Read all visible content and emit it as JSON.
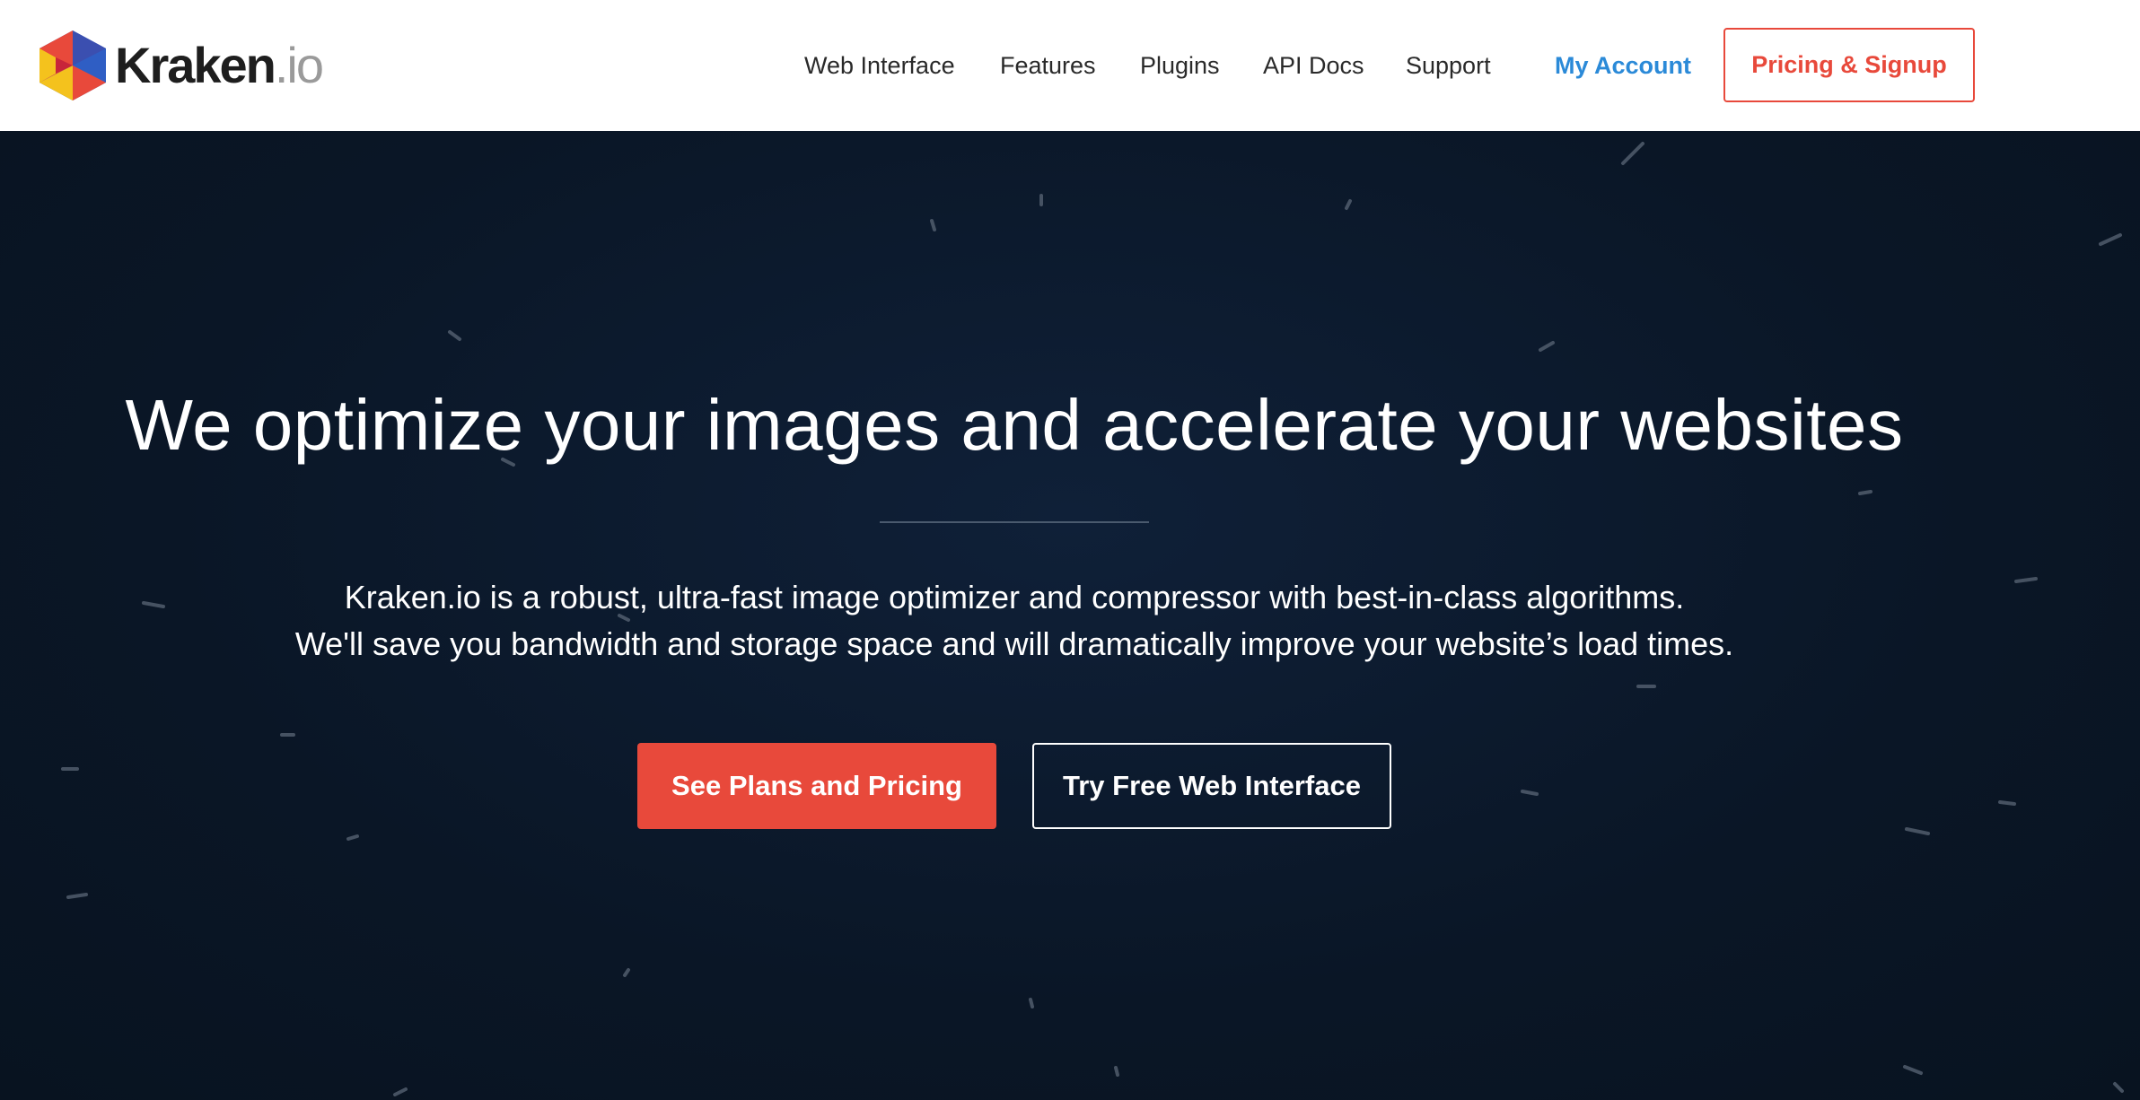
{
  "brand": {
    "word": "Kraken",
    "tld": ".io",
    "logo_icon": "hexagon-cube-icon",
    "colors": {
      "accent_red": "#e8493b",
      "accent_blue": "#2b8ad8",
      "hero_bg": "#0b1727"
    }
  },
  "nav": {
    "items": [
      {
        "label": "Web Interface"
      },
      {
        "label": "Features"
      },
      {
        "label": "Plugins"
      },
      {
        "label": "API Docs"
      },
      {
        "label": "Support"
      }
    ],
    "account_label": "My Account",
    "signup_label": "Pricing & Signup"
  },
  "hero": {
    "headline": "We optimize your images and accelerate your websites",
    "description": [
      "Kraken.io is a robust, ultra-fast image optimizer and compressor with best-in-class algorithms.",
      "We'll save you bandwidth and storage space and will dramatically improve your website’s load times."
    ],
    "primary_cta": "See Plans and Pricing",
    "secondary_cta": "Try Free Web Interface"
  }
}
